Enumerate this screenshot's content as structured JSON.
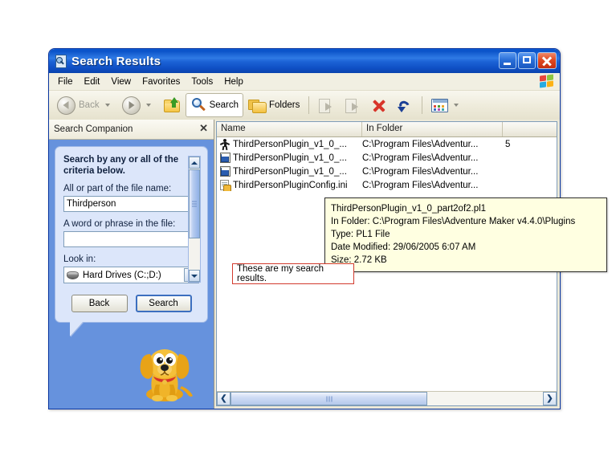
{
  "window": {
    "title": "Search Results",
    "icon": "search-document-icon",
    "buttons": {
      "minimize": "minimize-button",
      "maximize": "maximize-button",
      "close": "close-button"
    }
  },
  "menubar": {
    "items": [
      "File",
      "Edit",
      "View",
      "Favorites",
      "Tools",
      "Help"
    ],
    "logo": "windows-flag-icon"
  },
  "toolbar": {
    "back_label": "Back",
    "search_label": "Search",
    "folders_label": "Folders",
    "icons": [
      "back-icon",
      "forward-icon",
      "up-folder-icon",
      "search-icon",
      "folders-icon",
      "move-to-icon",
      "copy-to-icon",
      "delete-icon",
      "undo-icon",
      "views-icon"
    ]
  },
  "companion": {
    "header_title": "Search Companion",
    "close_label": "✕",
    "criteria_title": "Search by any or all of the criteria below.",
    "filename_label": "All or part of the file name:",
    "filename_value": "Thirdperson",
    "filename_placeholder": "",
    "phrase_label": "A word or phrase in the file:",
    "phrase_value": "",
    "phrase_placeholder": "",
    "lookin_label": "Look in:",
    "lookin_value": "Hard Drives (C:;D:)",
    "back_button": "Back",
    "search_button": "Search",
    "mascot": "rover-dog-icon"
  },
  "results": {
    "columns": [
      "Name",
      "In Folder",
      ""
    ],
    "rows": [
      {
        "icon": "person-file-icon",
        "name": "ThirdPersonPlugin_v1_0_...",
        "folder": "C:\\Program Files\\Adventur...",
        "size": "5"
      },
      {
        "icon": "window-file-icon",
        "name": "ThirdPersonPlugin_v1_0_...",
        "folder": "C:\\Program Files\\Adventur...",
        "size": ""
      },
      {
        "icon": "window-file-icon",
        "name": "ThirdPersonPlugin_v1_0_...",
        "folder": "C:\\Program Files\\Adventur...",
        "size": ""
      },
      {
        "icon": "ini-file-icon",
        "name": "ThirdPersonPluginConfig.ini",
        "folder": "C:\\Program Files\\Adventur...",
        "size": ""
      }
    ]
  },
  "tooltip": {
    "line1": "ThirdPersonPlugin_v1_0_part2of2.pl1",
    "line2": "In Folder: C:\\Program Files\\Adventure Maker v4.4.0\\Plugins",
    "line3": "Type: PL1 File",
    "line4": "Date Modified: 29/06/2005 6:07 AM",
    "line5": "Size: 2.72 KB"
  },
  "annotation": {
    "text": "These are my search results.",
    "border_color": "#d23b2e"
  },
  "colors": {
    "titlebar_blue": "#0a52c8",
    "companion_blue": "#6692dd",
    "balloon_blue": "#dce6fa",
    "chrome_tan": "#ece9d8",
    "tooltip_yellow": "#ffffe1"
  }
}
